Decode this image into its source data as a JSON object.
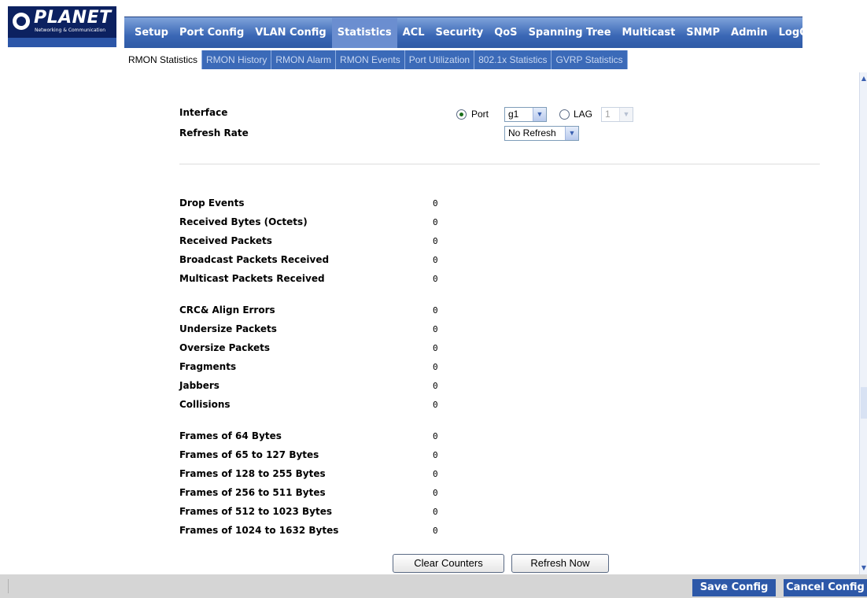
{
  "brand": {
    "logo_text": "PLANET",
    "logo_subtitle": "Networking & Communication"
  },
  "main_nav": [
    {
      "label": "Setup",
      "active": false
    },
    {
      "label": "Port Config",
      "active": false
    },
    {
      "label": "VLAN Config",
      "active": false
    },
    {
      "label": "Statistics",
      "active": true
    },
    {
      "label": "ACL",
      "active": false
    },
    {
      "label": "Security",
      "active": false
    },
    {
      "label": "QoS",
      "active": false
    },
    {
      "label": "Spanning Tree",
      "active": false
    },
    {
      "label": "Multicast",
      "active": false
    },
    {
      "label": "SNMP",
      "active": false
    },
    {
      "label": "Admin",
      "active": false
    },
    {
      "label": "LogOut",
      "active": false
    }
  ],
  "sub_nav": [
    {
      "label": "RMON Statistics",
      "active": true
    },
    {
      "label": "RMON History",
      "active": false
    },
    {
      "label": "RMON Alarm",
      "active": false
    },
    {
      "label": "RMON Events",
      "active": false
    },
    {
      "label": "Port Utilization",
      "active": false
    },
    {
      "label": "802.1x Statistics",
      "active": false
    },
    {
      "label": "GVRP Statistics",
      "active": false
    }
  ],
  "interface": {
    "label": "Interface",
    "port_option": "Port",
    "port_selected": true,
    "port_value": "g1",
    "lag_option": "LAG",
    "lag_selected": false,
    "lag_value": "1"
  },
  "refresh_rate": {
    "label": "Refresh Rate",
    "value": "No Refresh"
  },
  "stats_groups": [
    [
      {
        "label": "Drop Events",
        "value": "0"
      },
      {
        "label": "Received Bytes (Octets)",
        "value": "0"
      },
      {
        "label": "Received Packets",
        "value": "0"
      },
      {
        "label": "Broadcast Packets Received",
        "value": "0"
      },
      {
        "label": "Multicast Packets Received",
        "value": "0"
      }
    ],
    [
      {
        "label": "CRC& Align Errors",
        "value": "0"
      },
      {
        "label": "Undersize Packets",
        "value": "0"
      },
      {
        "label": "Oversize Packets",
        "value": "0"
      },
      {
        "label": "Fragments",
        "value": "0"
      },
      {
        "label": "Jabbers",
        "value": "0"
      },
      {
        "label": "Collisions",
        "value": "0"
      }
    ],
    [
      {
        "label": "Frames of 64 Bytes",
        "value": "0"
      },
      {
        "label": "Frames of 65 to 127 Bytes",
        "value": "0"
      },
      {
        "label": "Frames of 128 to 255 Bytes",
        "value": "0"
      },
      {
        "label": "Frames of 256 to 511 Bytes",
        "value": "0"
      },
      {
        "label": "Frames of 512 to 1023 Bytes",
        "value": "0"
      },
      {
        "label": "Frames of 1024 to 1632 Bytes",
        "value": "0"
      }
    ]
  ],
  "actions": {
    "clear_counters": "Clear Counters",
    "refresh_now": "Refresh Now"
  },
  "footer": {
    "save_config": "Save Config",
    "cancel_config": "Cancel Config"
  },
  "colors": {
    "nav_blue": "#3a67b5",
    "logo_navy": "#0c2160",
    "footer_button": "#2d58a8",
    "radio_dot": "#1a6e1a"
  }
}
